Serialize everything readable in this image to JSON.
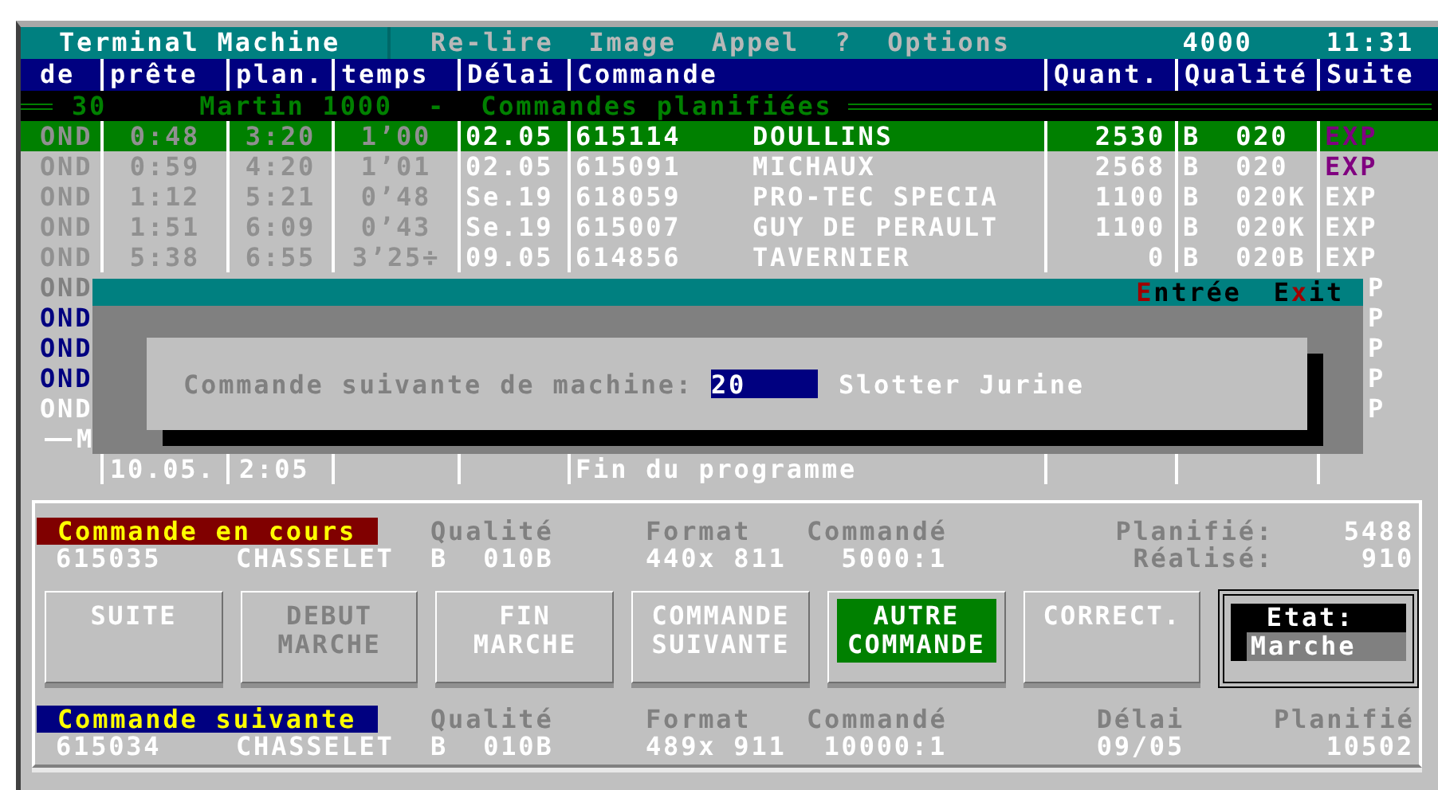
{
  "menu_bar": {
    "title": "Terminal Machine",
    "items": [
      {
        "label": "Re-lire",
        "disabled": true
      },
      {
        "label": "Image",
        "disabled": true
      },
      {
        "label": "Appel",
        "disabled": true
      },
      {
        "label": "?",
        "disabled": true
      },
      {
        "label": "Options",
        "disabled": true
      }
    ],
    "counter": "4000",
    "clock": "11:31"
  },
  "table": {
    "columns": [
      "de",
      "prête",
      "plan.",
      "temps",
      "Délai",
      "Commande",
      "Quant.",
      "Qualité",
      "Suite"
    ],
    "group": {
      "number": "30",
      "title": "Martin 1000  -  Commandes planifiées"
    },
    "rows": [
      {
        "de": "OND",
        "prete": "0:48",
        "plan": "3:20",
        "temps": "1’00",
        "delai": "02.05",
        "commande": "615114",
        "client": "DOULLINS",
        "quant": "2530",
        "qualite": "B  020",
        "suite": "EXP",
        "selected": true,
        "suite_flagged": true
      },
      {
        "de": "OND",
        "prete": "0:59",
        "plan": "4:20",
        "temps": "1’01",
        "delai": "02.05",
        "commande": "615091",
        "client": "MICHAUX",
        "quant": "2568",
        "qualite": "B  020",
        "suite": "EXP",
        "selected": false,
        "suite_flagged": true
      },
      {
        "de": "OND",
        "prete": "1:12",
        "plan": "5:21",
        "temps": "0’48",
        "delai": "Se.19",
        "commande": "618059",
        "client": "PRO-TEC SPECIA",
        "quant": "1100",
        "qualite": "B  020K",
        "suite": "EXP",
        "selected": false,
        "suite_flagged": false
      },
      {
        "de": "OND",
        "prete": "1:51",
        "plan": "6:09",
        "temps": "0’43",
        "delai": "Se.19",
        "commande": "615007",
        "client": "GUY DE PERAULT",
        "quant": "1100",
        "qualite": "B  020K",
        "suite": "EXP",
        "selected": false,
        "suite_flagged": false
      },
      {
        "de": "OND",
        "prete": "5:38",
        "plan": "6:55",
        "temps": "3’25÷",
        "delai": "09.05",
        "commande": "614856",
        "client": "TAVERNIER",
        "quant": "0",
        "qualite": "B  020B",
        "suite": "EXP",
        "selected": false,
        "suite_flagged": false
      }
    ],
    "hidden_rows": [
      {
        "de": "OND",
        "suite": "P",
        "color": "#808080"
      },
      {
        "de": "OND",
        "suite": "P",
        "color": "#000080"
      },
      {
        "de": "OND",
        "suite": "P",
        "color": "#000080"
      },
      {
        "de": "OND",
        "suite": "P",
        "color": "#000080"
      },
      {
        "de": "OND",
        "suite": "P",
        "color": "#ffffff"
      }
    ],
    "section_label": "M",
    "footer": {
      "prete": "10.05.",
      "plan": "2:05",
      "commande": "Fin du programme"
    }
  },
  "dialog": {
    "actions": [
      {
        "key": "E",
        "after": "ntrée"
      },
      {
        "before": "E",
        "key": "x",
        "after": "it"
      }
    ],
    "prompt": "Commande suivante de machine:",
    "value": "20",
    "machine": "Slotter Jurine"
  },
  "orders": [
    {
      "title": "Commande en cours",
      "color": "#800000",
      "headings": [
        "Qualité",
        "Format",
        "Commandé",
        "Planifié:",
        "5488"
      ],
      "values": [
        "615035",
        "CHASSELET",
        "B  010B",
        "440x 811",
        "5000:1",
        "Réalisé:",
        "910"
      ]
    },
    {
      "title": "Commande suivante",
      "color": "#000080",
      "headings": [
        "Qualité",
        "Format",
        "Commandé",
        "Délai",
        "Planifié"
      ],
      "values": [
        "615034",
        "CHASSELET",
        "B  010B",
        "489x 911",
        "10000:1",
        "09/05",
        "10502"
      ]
    }
  ],
  "buttons": [
    {
      "label": "SUITE",
      "disabled": false,
      "selected": false
    },
    {
      "label": "DEBUT MARCHE",
      "disabled": true,
      "selected": false
    },
    {
      "label": "FIN MARCHE",
      "disabled": false,
      "selected": false
    },
    {
      "label": "COMMANDE SUIVANTE",
      "disabled": false,
      "selected": false
    },
    {
      "label": "AUTRE COMMANDE",
      "disabled": false,
      "selected": true
    },
    {
      "label": "CORRECT.",
      "disabled": false,
      "selected": false
    }
  ],
  "status": {
    "label": "Etat:",
    "value": "Marche"
  }
}
